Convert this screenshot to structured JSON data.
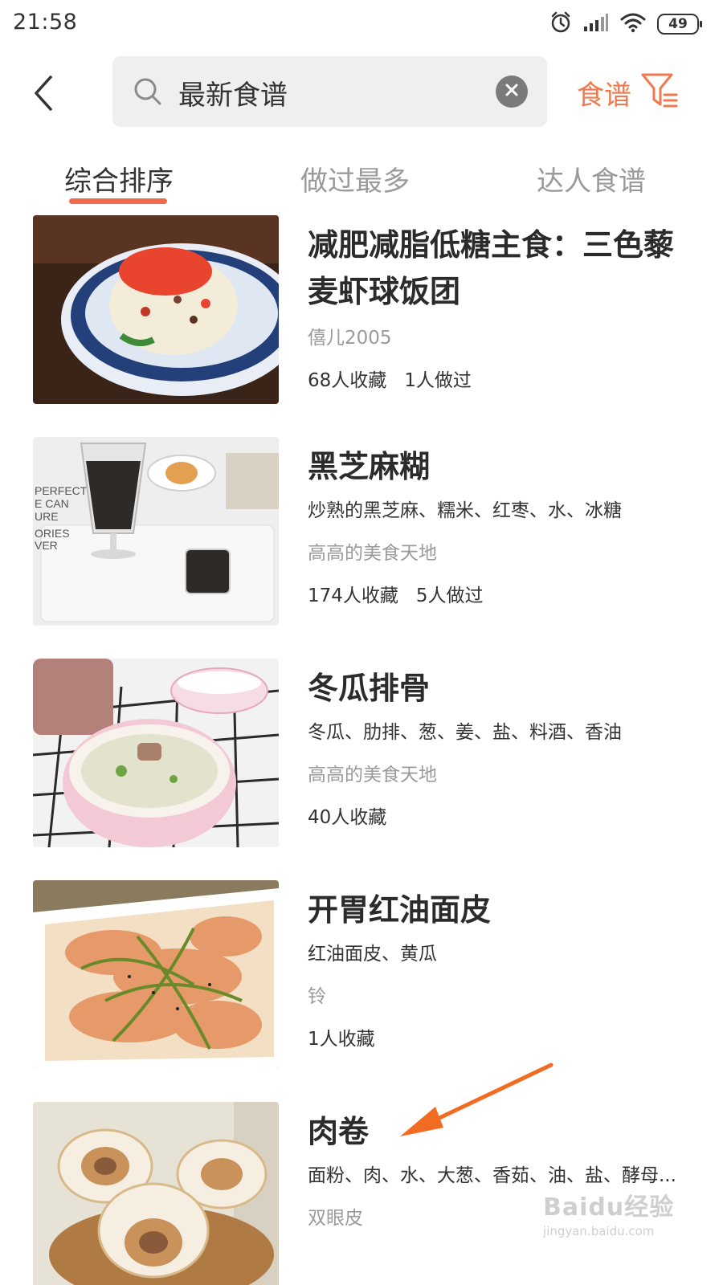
{
  "status_bar": {
    "time": "21:58",
    "battery": "49",
    "icons": [
      "alarm-icon",
      "signal-icon",
      "wifi-icon",
      "battery-icon"
    ]
  },
  "header": {
    "back_icon": "chevron-left-icon",
    "search": {
      "value": "最新食谱",
      "icon": "search-icon",
      "clear_icon": "clear-icon"
    },
    "filter_label": "食谱",
    "filter_icon": "filter-icon",
    "accent_color": "#ef7a4f"
  },
  "tabs": [
    {
      "label": "综合排序",
      "active": true
    },
    {
      "label": "做过最多",
      "active": false
    },
    {
      "label": "达人食谱",
      "active": false
    }
  ],
  "recipes": [
    {
      "title": "减肥减脂低糖主食：三色藜麦虾球饭团",
      "ingredients": "",
      "author": "僖儿2005",
      "stats": "68人收藏   1人做过",
      "image": "shrimp-quinoa-rice-ball-photo"
    },
    {
      "title": "黑芝麻糊",
      "ingredients": "炒熟的黑芝麻、糯米、红枣、水、冰糖",
      "author": "高高的美食天地",
      "stats": "174人收藏   5人做过",
      "image": "black-sesame-paste-photo"
    },
    {
      "title": "冬瓜排骨",
      "ingredients": "冬瓜、肋排、葱、姜、盐、料酒、香油",
      "author": "高高的美食天地",
      "stats": "40人收藏",
      "image": "winter-melon-ribs-soup-photo"
    },
    {
      "title": "开胃红油面皮",
      "ingredients": "红油面皮、黄瓜",
      "author": "铃",
      "stats": "1人收藏",
      "image": "spicy-noodle-sheets-photo"
    },
    {
      "title": "肉卷",
      "ingredients": "面粉、肉、水、大葱、香茹、油、盐、酵母...",
      "author": "双眼皮",
      "stats": "",
      "image": "meat-roll-photo"
    }
  ],
  "watermark": {
    "top": "Baidu经验",
    "bottom": "jingyan.baidu.com"
  }
}
